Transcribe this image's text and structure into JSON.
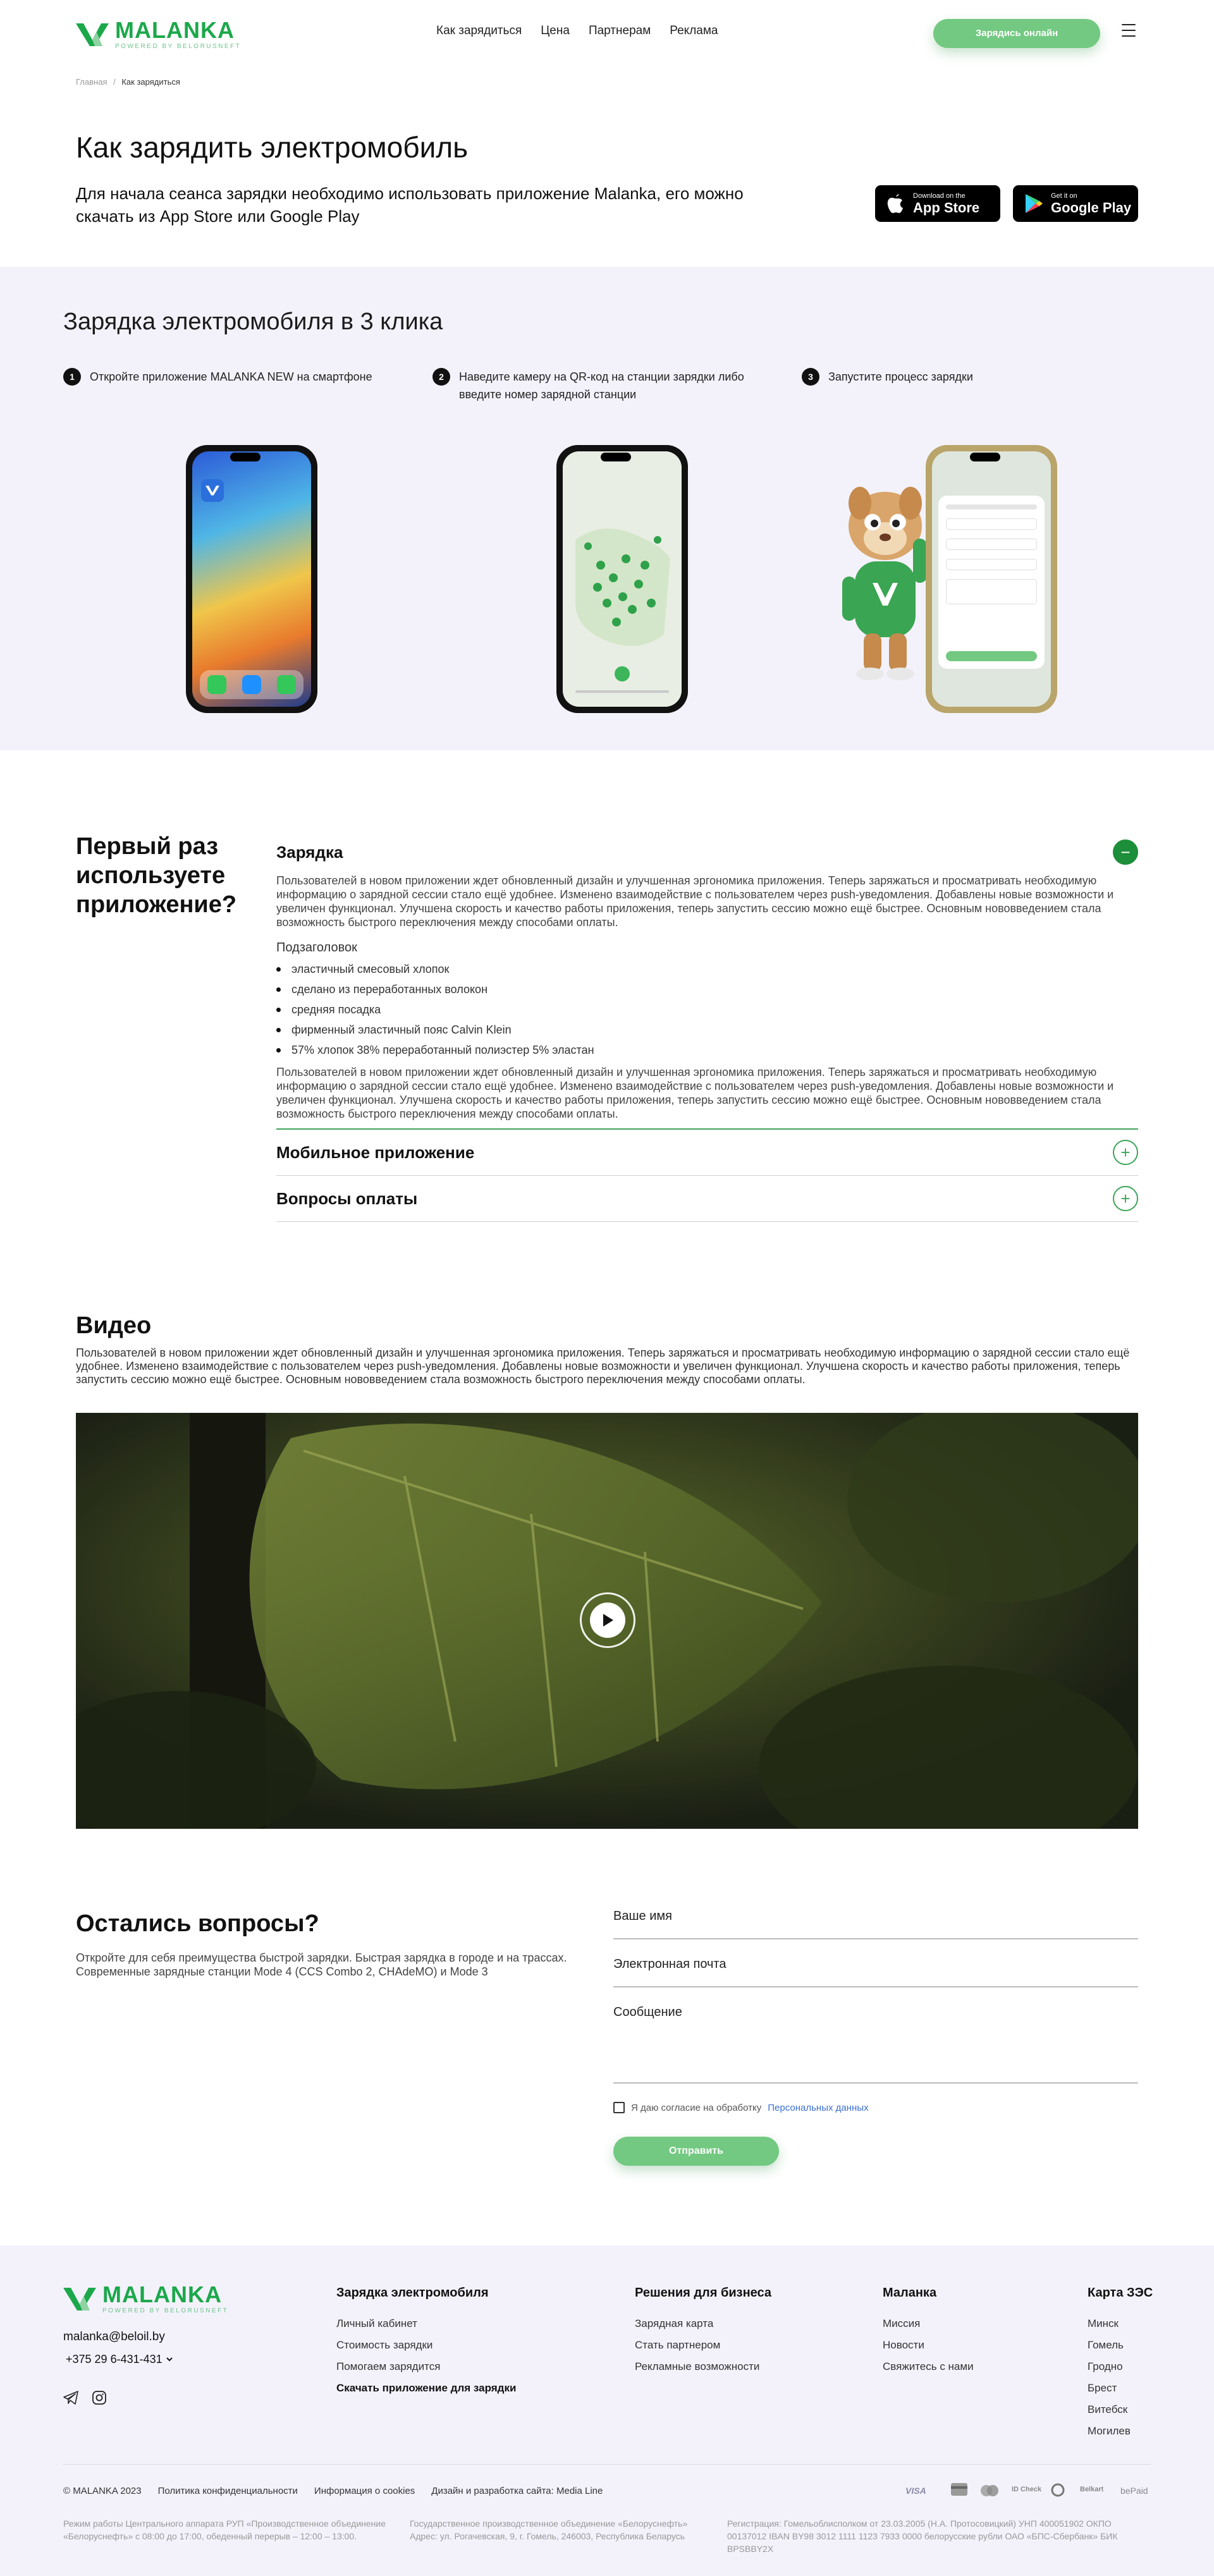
{
  "header": {
    "logo": {
      "brand": "MALANKA",
      "sub": "POWERED BY BELORUSNEFT"
    },
    "nav": [
      "Как зарядиться",
      "Цена",
      "Партнерам",
      "Реклама"
    ],
    "cta": "Зарядись онлайн"
  },
  "breadcrumb": {
    "home": "Главная",
    "sep": "/",
    "current": "Как зарядиться"
  },
  "hero": {
    "title": "Как зарядить электромобиль",
    "lead": "Для начала сеанса зарядки необходимо использовать приложение Malanka, его можно скачать из App Store или Google Play",
    "appstore": {
      "small": "Download on the",
      "big": "App Store"
    },
    "googleplay": {
      "small": "Get it on",
      "big": "Google Play"
    }
  },
  "steps": {
    "title": "Зарядка электромобиля в 3 клика",
    "items": [
      {
        "num": "1",
        "text": "Откройте приложение MALANKA NEW на смартфоне"
      },
      {
        "num": "2",
        "text": "Наведите камеру на QR-код на станции зарядки либо введите номер зарядной станции"
      },
      {
        "num": "3",
        "text": "Запустите процесс зарядки"
      }
    ]
  },
  "faq": {
    "title": "Первый раз используете приложение?",
    "items": [
      {
        "title": "Зарядка",
        "open": true,
        "para1": "Пользователей в новом приложении ждет обновленный дизайн и улучшенная эргономика приложения. Теперь заряжаться и просматривать необходимую информацию о зарядной сессии стало ещё удобнее. Изменено взаимодействие с пользователем через push-уведомления. Добавлены новые возможности и увеличен функционал. Улучшена скорость и качество работы приложения, теперь запустить сессию можно ещё быстрее. Основным нововведением стала возможность быстрого переключения между способами оплаты.",
        "subheading": "Подзаголовок",
        "list": [
          "эластичный смесовый хлопок",
          "сделано из переработанных волокон",
          "средняя посадка",
          "фирменный эластичный пояс Calvin Klein",
          "57% хлопок 38% переработанный полиэстер 5% эластан"
        ],
        "para2": "Пользователей в новом приложении ждет обновленный дизайн и улучшенная эргономика приложения. Теперь заряжаться и просматривать необходимую информацию о зарядной сессии стало ещё удобнее. Изменено взаимодействие с пользователем через push-уведомления. Добавлены новые возможности и увеличен функционал. Улучшена скорость и качество работы приложения, теперь запустить сессию можно ещё быстрее. Основным нововведением стала возможность быстрого переключения между способами оплаты."
      },
      {
        "title": "Мобильное приложение",
        "open": false
      },
      {
        "title": "Вопросы оплаты",
        "open": false
      }
    ]
  },
  "video": {
    "title": "Видео",
    "text": "Пользователей в новом приложении ждет обновленный дизайн и улучшенная эргономика приложения. Теперь заряжаться и просматривать необходимую информацию о зарядной сессии стало ещё удобнее. Изменено взаимодействие с пользователем через push-уведомления. Добавлены новые возможности и увеличен функционал. Улучшена скорость и качество работы приложения, теперь запустить сессию можно ещё быстрее. Основным нововведением стала возможность быстрого переключения между способами оплаты."
  },
  "contact": {
    "title": "Остались вопросы?",
    "text": "Откройте для себя преимущества быстрой зарядки. Быстрая зарядка в городе и на трассах. Современные зарядные станции Mode 4 (CCS Combo 2, CHAdeMO) и Mode 3",
    "name_label": "Ваше имя",
    "email_label": "Электронная почта",
    "message_label": "Сообщение",
    "consent_text": "Я даю согласие на обработку",
    "consent_link": "Персональных данных",
    "submit": "Отправить"
  },
  "footer": {
    "email": "malanka@beloil.by",
    "phone": "+375 29 6-431-431",
    "col1": {
      "title": "Зарядка электромобиля",
      "links": [
        "Личный кабинет",
        "Стоимость зарядки",
        "Помогаем зарядится",
        "Скачать приложение для зарядки"
      ]
    },
    "col2": {
      "title": "Решения для бизнеса",
      "links": [
        "Зарядная карта",
        "Стать партнером",
        "Рекламные возможности"
      ]
    },
    "col3": {
      "title": "Маланка",
      "links": [
        "Миссия",
        "Новости",
        "Свяжитесь с нами"
      ]
    },
    "col4": {
      "title": "Карта ЗЭС",
      "links": [
        "Минск",
        "Гомель",
        "Гродно",
        "Брест",
        "Витебск",
        "Могилев"
      ]
    },
    "bottom": [
      "© MALANKA 2023",
      "Политика конфиденциальности",
      "Информация о cookies",
      "Дизайн и разработка сайта: Media Line"
    ],
    "payments": [
      "VISA",
      "MasterCard",
      "ID Check",
      "Белкарт",
      "Belkart",
      "bePaid"
    ],
    "info1": "Режим работы Центрального аппарата РУП «Производственное объединение «Белоруснефть» с 08:00 до 17:00, обеденный перерыв – 12:00 – 13:00.",
    "info2": "Государственное производственное объединение «Белоруснефть» Адрес: ул. Рогачевская, 9, г. Гомель, 246003, Республика Беларусь",
    "info3": "Регистрация: Гомельоблисполком от 23.03.2005 (Н.А. Протосовицкий) УНП 400051902 ОКПО 00137012 IBAN BY98 3012 1111 1123 7933 0000 белорусские рубли ОАО «БПС-Сбербанк» БИК BPSBBY2X"
  },
  "colors": {
    "accent": "#1ba84a",
    "button": "#73c981",
    "section_bg": "#f3f2fb"
  }
}
